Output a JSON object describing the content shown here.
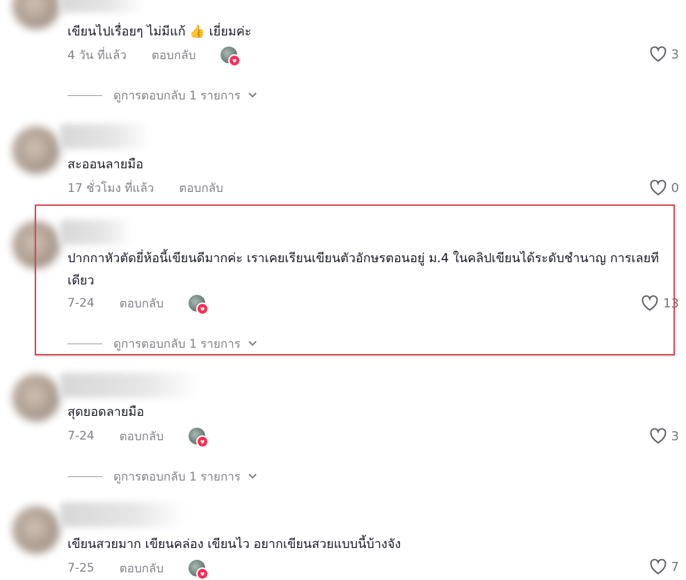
{
  "comments": [
    {
      "text": "เขียนไปเรื่อยๆ ไม่มีแก้ 👍 เยี่ยมค่ะ",
      "date": "4 วัน ที่แล้ว",
      "reply_label": "ตอบกลับ",
      "likes": "3",
      "creator_liked": true,
      "view_replies": "ดูการตอบกลับ 1 รายการ"
    },
    {
      "text": "สะออนลายมือ",
      "date": "17 ชั่วโมง ที่แล้ว",
      "reply_label": "ตอบกลับ",
      "likes": "0",
      "creator_liked": false
    },
    {
      "text": "ปากกาหัวตัดยี่ห้อนี้เขียนดีมากค่ะ เราเคยเรียนเขียนตัวอักษรตอนอยู่ ม.4 ในคลิปเขียนได้ระดับชำนาญ การเลยทีเดียว",
      "date": "7-24",
      "reply_label": "ตอบกลับ",
      "likes": "13",
      "creator_liked": true,
      "view_replies": "ดูการตอบกลับ 1 รายการ",
      "highlighted": true
    },
    {
      "text": "สุดยอดลายมือ",
      "date": "7-24",
      "reply_label": "ตอบกลับ",
      "likes": "3",
      "creator_liked": true,
      "view_replies": "ดูการตอบกลับ 1 รายการ"
    },
    {
      "text": "เขียนสวยมาก เขียนคล่อง เขียนไว อยากเขียนสวยแบบนี้บ้างจัง",
      "date": "7-25",
      "reply_label": "ตอบกลับ",
      "likes": "7",
      "creator_liked": true
    }
  ],
  "colors": {
    "highlight_border": "#e0454f",
    "heart_badge": "#fe2c55"
  },
  "icons": {
    "like": "heart-outline-icon",
    "expand": "chevron-down-icon",
    "creator_badge": "heart-badge-icon"
  }
}
